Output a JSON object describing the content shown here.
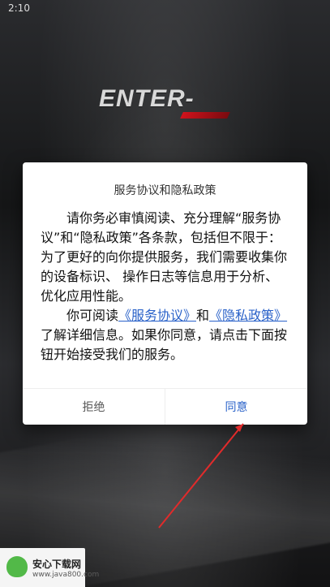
{
  "status_bar": {
    "time": "2:10"
  },
  "logo": {
    "text": "ENTER-"
  },
  "dialog": {
    "title": "服务协议和隐私政策",
    "paragraph1": "请你务必审慎阅读、充分理解“服务协议”和“隐私政策”各条款，包括但不限于：为了更好的向你提供服务，我们需要收集你的设备标识、 操作日志等信息用于分析、优化应用性能。",
    "paragraph2_prefix": "你可阅读",
    "service_link": "《服务协议》",
    "and_text": "和",
    "privacy_link": "《隐私政策》",
    "paragraph2_suffix": "了解详细信息。如果你同意，请点击下面按钮开始接受我们的服务。",
    "buttons": {
      "reject": "拒绝",
      "agree": "同意"
    }
  },
  "watermark": {
    "title": "安心下载网",
    "url": "www.java800.com"
  },
  "colors": {
    "link": "#2a62c9",
    "arrow": "#e12b2b",
    "logo_red": "#d0121c"
  }
}
